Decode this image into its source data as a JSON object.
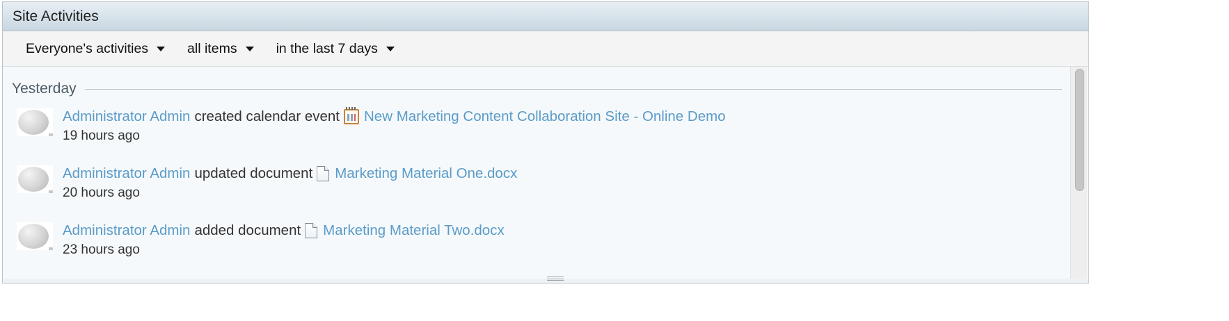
{
  "dashlet": {
    "title": "Site Activities"
  },
  "filters": {
    "who": "Everyone's activities",
    "what": "all items",
    "when": "in the last 7 days"
  },
  "day_group": {
    "label": "Yesterday"
  },
  "activities": [
    {
      "user": "Administrator Admin",
      "action": "created calendar event",
      "icon": "calendar-icon",
      "item": "New Marketing Content Collaboration Site - Online Demo",
      "time": "19 hours ago"
    },
    {
      "user": "Administrator Admin",
      "action": "updated document",
      "icon": "document-icon",
      "item": "Marketing Material One.docx",
      "time": "20 hours ago"
    },
    {
      "user": "Administrator Admin",
      "action": "added document",
      "icon": "document-icon",
      "item": "Marketing Material Two.docx",
      "time": "23 hours ago"
    }
  ],
  "colors": {
    "link": "#5b9bc9",
    "title_bar_top": "#e7eef3",
    "title_bar_bottom": "#c9d7e1",
    "body_bg": "#f5f9fb"
  }
}
